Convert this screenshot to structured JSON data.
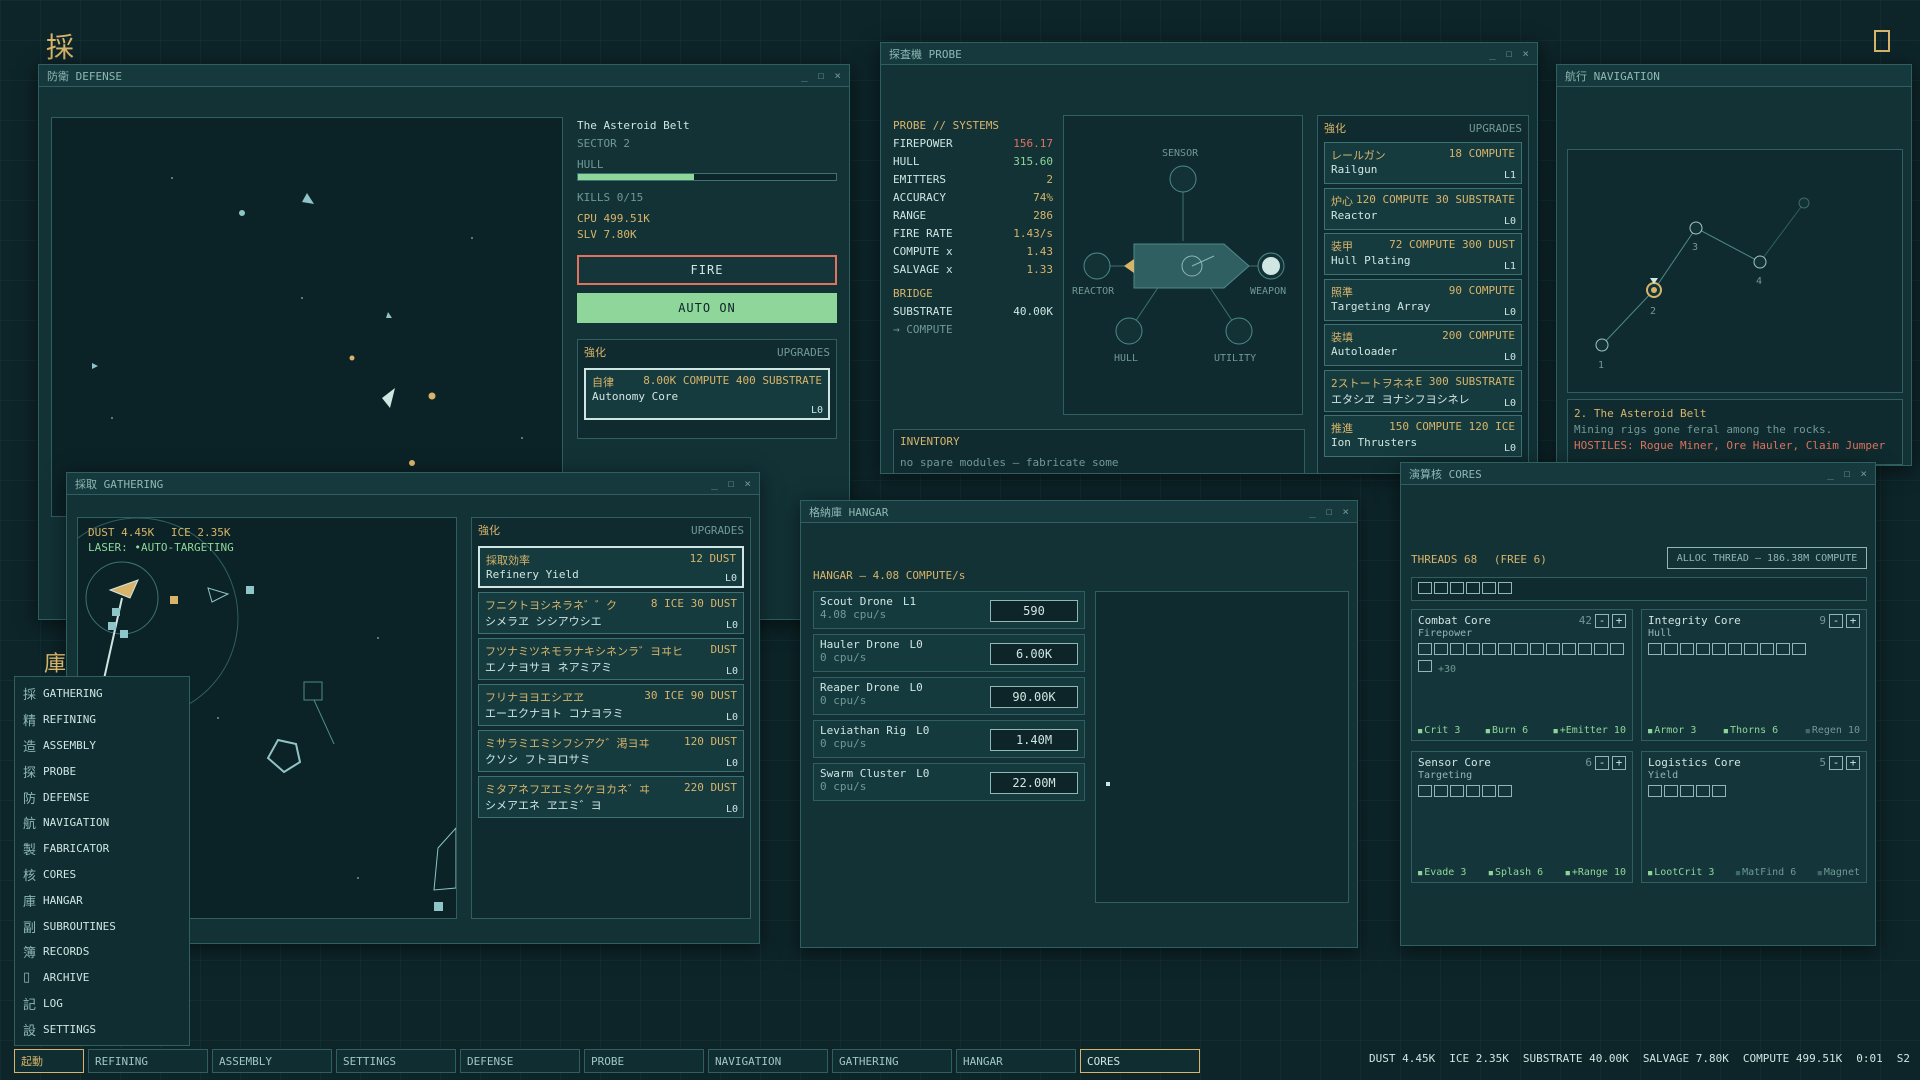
{
  "app": {
    "logo": "採",
    "corner_icon": "archive-icon"
  },
  "defense": {
    "title": "防衛 DEFENSE",
    "location": "The Asteroid Belt",
    "sector": "SECTOR 2",
    "hull_label": "HULL",
    "hull_fraction": 0.45,
    "kills": "KILLS 0/15",
    "cpu": "CPU 499.51K",
    "slv": "SLV 7.80K",
    "fire_label": "FIRE",
    "auto_label": "AUTO ON",
    "upgrades_jp": "強化",
    "upgrades_label": "UPGRADES",
    "upgrade": {
      "jp": "自律",
      "cost": "8.00K COMPUTE 400 SUBSTRATE",
      "name": "Autonomy Core",
      "level": "L0"
    }
  },
  "probe": {
    "title": "探査機 PROBE",
    "systems_label": "PROBE // SYSTEMS",
    "stats": [
      {
        "label": "FIREPOWER",
        "value": "156.17"
      },
      {
        "label": "HULL",
        "value": "315.60"
      },
      {
        "label": "EMITTERS",
        "value": "2"
      },
      {
        "label": "ACCURACY",
        "value": "74%"
      },
      {
        "label": "RANGE",
        "value": "286"
      },
      {
        "label": "FIRE RATE",
        "value": "1.43/s"
      },
      {
        "label": "COMPUTE x",
        "value": "1.43"
      },
      {
        "label": "SALVAGE x",
        "value": "1.33"
      }
    ],
    "bridge_label": "BRIDGE",
    "substrate_label": "SUBSTRATE",
    "substrate_value": "40.00K",
    "compute_link": "→ COMPUTE",
    "nodes": {
      "sensor": "SENSOR",
      "reactor": "REACTOR",
      "weapon": "WEAPON",
      "hull": "HULL",
      "utility": "UTILITY"
    },
    "inventory_label": "INVENTORY",
    "inventory_empty": "no spare modules — fabricate some",
    "upgrades_jp": "強化",
    "upgrades_label": "UPGRADES",
    "upgrades": [
      {
        "jp": "レールガン",
        "cost": "18 COMPUTE",
        "name": "Railgun",
        "level": "L1"
      },
      {
        "jp": "炉心",
        "cost": "120 COMPUTE 30 SUBSTRATE",
        "name": "Reactor",
        "level": "L0"
      },
      {
        "jp": "装甲",
        "cost": "72 COMPUTE 300 DUST",
        "name": "Hull Plating",
        "level": "L1"
      },
      {
        "jp": "照準",
        "cost": "90 COMPUTE",
        "name": "Targeting Array",
        "level": "L0"
      },
      {
        "jp": "装填",
        "cost": "200 COMPUTE",
        "name": "Autoloader",
        "level": "L0"
      },
      {
        "jp": "2ストートヲネネ",
        "cost": "E 300 SUBSTRATE",
        "name": "エタシヱ ヨナシフヨシネレ",
        "level": "L0"
      },
      {
        "jp": "推進",
        "cost": "150 COMPUTE 120 ICE",
        "name": "Ion Thrusters",
        "level": "L0"
      }
    ]
  },
  "navigation": {
    "title": "航行 NAVIGATION",
    "nodes": [
      "1",
      "2",
      "3",
      "4"
    ],
    "location": "2. The Asteroid Belt",
    "desc": "Mining rigs gone feral among the rocks.",
    "hostiles": "HOSTILES: Rogue Miner, Ore Hauler, Claim Jumper"
  },
  "gathering": {
    "title": "採取 GATHERING",
    "dust": "DUST 4.45K",
    "ice": "ICE 2.35K",
    "laser": "LASER: •AUTO-TARGETING",
    "upgrades_jp": "強化",
    "upgrades_label": "UPGRADES",
    "upgrades": [
      {
        "jp": "採取効率",
        "cost": "12 DUST",
        "name": "Refinery Yield",
        "level": "L0"
      },
      {
        "jp": "フニクトヨシネラネ゛゛ク",
        "cost": "8 ICE 30 DUST",
        "name": "シメラヱ シシアウシエ",
        "level": "L0"
      },
      {
        "jp": "フツナミツネモラナキシネンラ゛ヨヰヒ",
        "cost": "DUST",
        "name": "エノナヨサヨ ネアミアミ",
        "level": "L0"
      },
      {
        "jp": "フリナヨヨエシヱヱ",
        "cost": "30 ICE 90 DUST",
        "name": "エーエクナヨト コナヨラミ",
        "level": "L0"
      },
      {
        "jp": "ミサラミエミシフシアク゛渇ヨヰ",
        "cost": "120 DUST",
        "name": "クソシ フトヨロサミ",
        "level": "L0"
      },
      {
        "jp": "ミタアネフヱエミクケヨカネ゛ヰ",
        "cost": "220 DUST",
        "name": "シメアエネ ヱエミ゛ヨ",
        "level": "L0"
      }
    ]
  },
  "hangar": {
    "title": "格納庫 HANGAR",
    "rate": "HANGAR  —  4.08 COMPUTE/s",
    "drones": [
      {
        "name": "Scout Drone",
        "level": "L1",
        "rate": "4.08 cpu/s",
        "cost": "590"
      },
      {
        "name": "Hauler Drone",
        "level": "L0",
        "rate": "0 cpu/s",
        "cost": "6.00K"
      },
      {
        "name": "Reaper Drone",
        "level": "L0",
        "rate": "0 cpu/s",
        "cost": "90.00K"
      },
      {
        "name": "Leviathan Rig",
        "level": "L0",
        "rate": "0 cpu/s",
        "cost": "1.40M"
      },
      {
        "name": "Swarm Cluster",
        "level": "L0",
        "rate": "0 cpu/s",
        "cost": "22.00M"
      }
    ]
  },
  "cores": {
    "title": "演算核 CORES",
    "threads": "THREADS  68",
    "free": "(FREE 6)",
    "alloc_button": "ALLOC THREAD — 186.38M COMPUTE",
    "cores": [
      {
        "name": "Combat Core",
        "count": "42",
        "tag": "Firepower",
        "extra": "+30",
        "perks": [
          "Crit 3",
          "Burn 6",
          "+Emitter 10"
        ]
      },
      {
        "name": "Integrity Core",
        "count": "9",
        "tag": "Hull",
        "perks": [
          "Armor 3",
          "Thorns 6",
          "Regen 10"
        ]
      },
      {
        "name": "Sensor Core",
        "count": "6",
        "tag": "Targeting",
        "perks": [
          "Evade 3",
          "Splash 6",
          "+Range 10"
        ]
      },
      {
        "name": "Logistics Core",
        "count": "5",
        "tag": "Yield",
        "perks": [
          "LootCrit 3",
          "MatFind 6",
          "Magnet"
        ]
      }
    ]
  },
  "nav_menu": {
    "items": [
      {
        "ic": "採",
        "label": "GATHERING"
      },
      {
        "ic": "精",
        "label": "REFINING"
      },
      {
        "ic": "造",
        "label": "ASSEMBLY"
      },
      {
        "ic": "探",
        "label": "PROBE"
      },
      {
        "ic": "防",
        "label": "DEFENSE"
      },
      {
        "ic": "航",
        "label": "NAVIGATION"
      },
      {
        "ic": "製",
        "label": "FABRICATOR"
      },
      {
        "ic": "核",
        "label": "CORES"
      },
      {
        "ic": "庫",
        "label": "HANGAR"
      },
      {
        "ic": "副",
        "label": "SUBROUTINES"
      },
      {
        "ic": "簿",
        "label": "RECORDS"
      },
      {
        "ic": "▯",
        "label": "ARCHIVE"
      },
      {
        "ic": "記",
        "label": "LOG"
      },
      {
        "ic": "設",
        "label": "SETTINGS"
      }
    ],
    "side_glyph": "庫"
  },
  "taskbar": {
    "start": "起動",
    "tasks": [
      "REFINING",
      "ASSEMBLY",
      "SETTINGS",
      "DEFENSE",
      "PROBE",
      "NAVIGATION",
      "GATHERING",
      "HANGAR",
      "CORES"
    ],
    "resources": [
      "DUST 4.45K",
      "ICE 2.35K",
      "SUBSTRATE 40.00K",
      "SALVAGE 7.80K",
      "COMPUTE 499.51K",
      "0:01",
      "S2"
    ]
  }
}
